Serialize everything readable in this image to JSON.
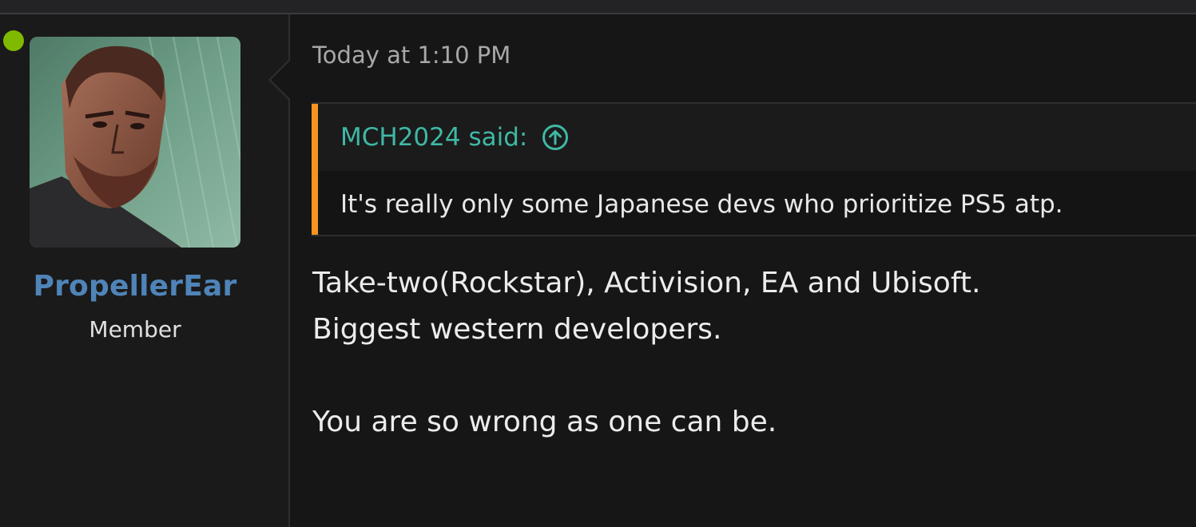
{
  "user": {
    "name": "PropellerEar",
    "title": "Member",
    "avatar_icon": "avatar-image",
    "online_color": "#7fba00"
  },
  "post": {
    "date": "Today at 1:10 PM",
    "quote": {
      "author": "MCH2024 said:",
      "jump_icon": "arrow-up-circle-icon",
      "text": "It's really only some Japanese devs who prioritize PS5 atp.",
      "accent_color": "#f7941d",
      "author_color": "#3fb8a5"
    },
    "lines": [
      "Take-two(Rockstar), Activision, EA and Ubisoft.",
      "Biggest western developers.",
      "You are so wrong as one can be."
    ]
  }
}
